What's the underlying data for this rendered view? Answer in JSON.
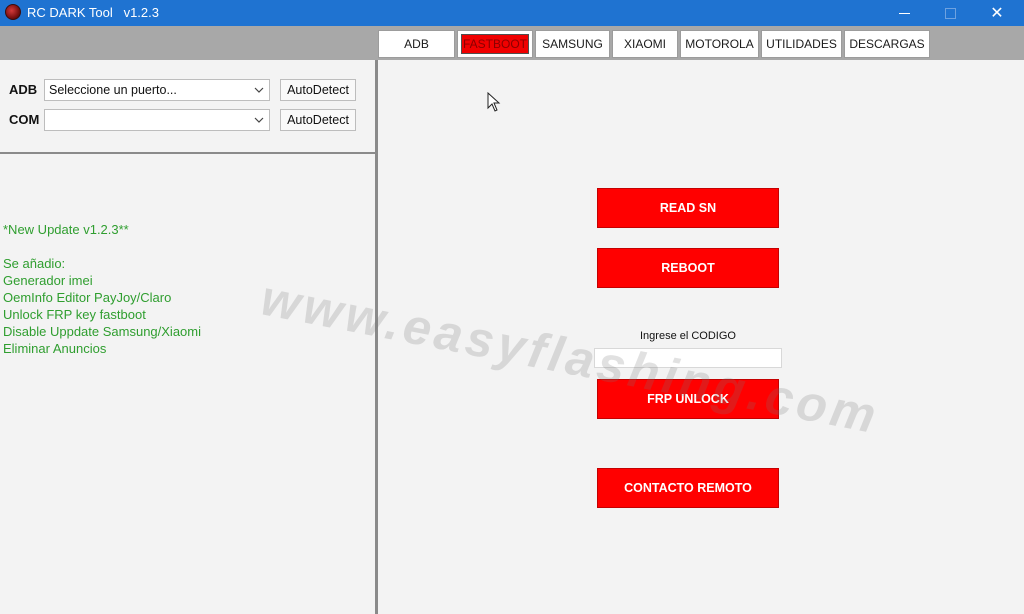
{
  "window": {
    "title": "RC DARK Tool   v1.2.3",
    "controls": {
      "minimize_icon": "minimize-icon",
      "maximize_icon": "maximize-icon",
      "close_icon": "close-icon",
      "close_glyph": "✕"
    }
  },
  "tabs": [
    {
      "label": "ADB"
    },
    {
      "label": "FASTBOOT",
      "active": true
    },
    {
      "label": "SAMSUNG"
    },
    {
      "label": "XIAOMI"
    },
    {
      "label": "MOTOROLA"
    },
    {
      "label": "UTILIDADES"
    },
    {
      "label": "DESCARGAS"
    }
  ],
  "ports": {
    "adb": {
      "label": "ADB",
      "value": "Seleccione un puerto...",
      "button": "AutoDetect"
    },
    "com": {
      "label": "COM",
      "value": "",
      "button": "AutoDetect"
    }
  },
  "log": {
    "lines": [
      "*New Update v1.2.3**",
      "",
      "Se añadio:",
      "Generador imei",
      "OemInfo Editor PayJoy/Claro",
      "Unlock FRP key fastboot",
      "Disable Uppdate Samsung/Xiaomi",
      "Eliminar Anuncios"
    ]
  },
  "fastboot": {
    "read_sn": "READ SN",
    "reboot": "REBOOT",
    "code_label": "Ingrese el CODIGO",
    "code_value": "",
    "frp_unlock": "FRP UNLOCK",
    "contacto_remoto": "CONTACTO REMOTO"
  },
  "watermark": "www.easyflashing.com",
  "colors": {
    "titlebar": "#1f73d1",
    "action_button": "#ff0000",
    "log_text": "#2f9e2f",
    "active_tab": "#f00000"
  }
}
